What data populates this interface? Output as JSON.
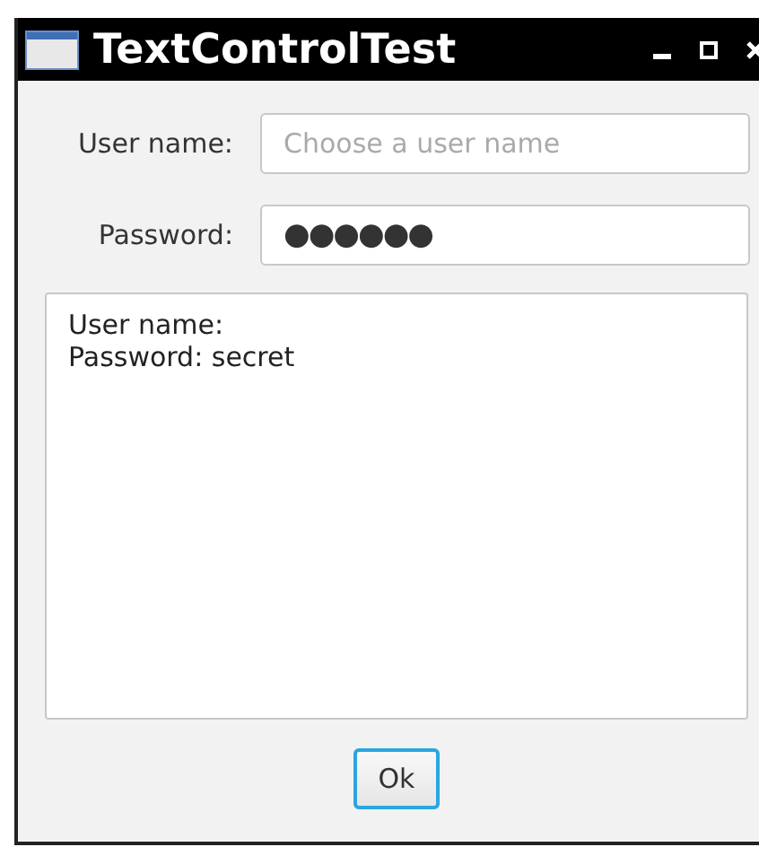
{
  "window": {
    "title": "TextControlTest"
  },
  "fields": [
    {
      "label": "User name:",
      "placeholder": "Choose a user name",
      "kind": "text"
    },
    {
      "label": "Password:",
      "value": "●●●●●●",
      "kind": "password"
    }
  ],
  "output": {
    "lines": [
      "User name:",
      "Password: secret"
    ]
  },
  "buttons": [
    {
      "label": "Ok",
      "focused": true
    }
  ]
}
